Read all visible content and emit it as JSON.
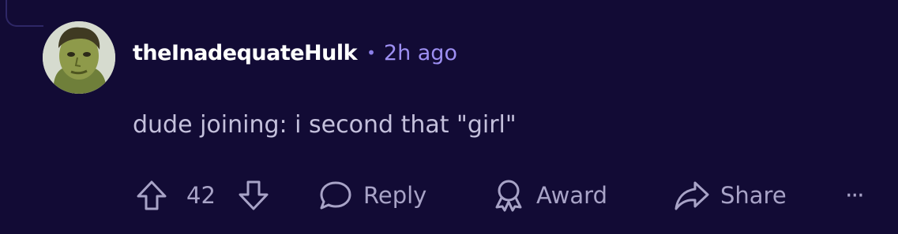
{
  "comment": {
    "username": "theInadequateHulk",
    "separator": "•",
    "timestamp": "2h ago",
    "body": "dude joining: i second that \"girl\"",
    "avatar_icon": "hulk-avatar"
  },
  "actions": {
    "vote_count": "42",
    "reply_label": "Reply",
    "award_label": "Award",
    "share_label": "Share",
    "more_label": "···"
  },
  "colors": {
    "background": "#120b35",
    "username": "#ffffff",
    "timestamp": "#9d8ff2",
    "body_text": "#c4c0dc",
    "action_text": "#a8a3c7"
  }
}
